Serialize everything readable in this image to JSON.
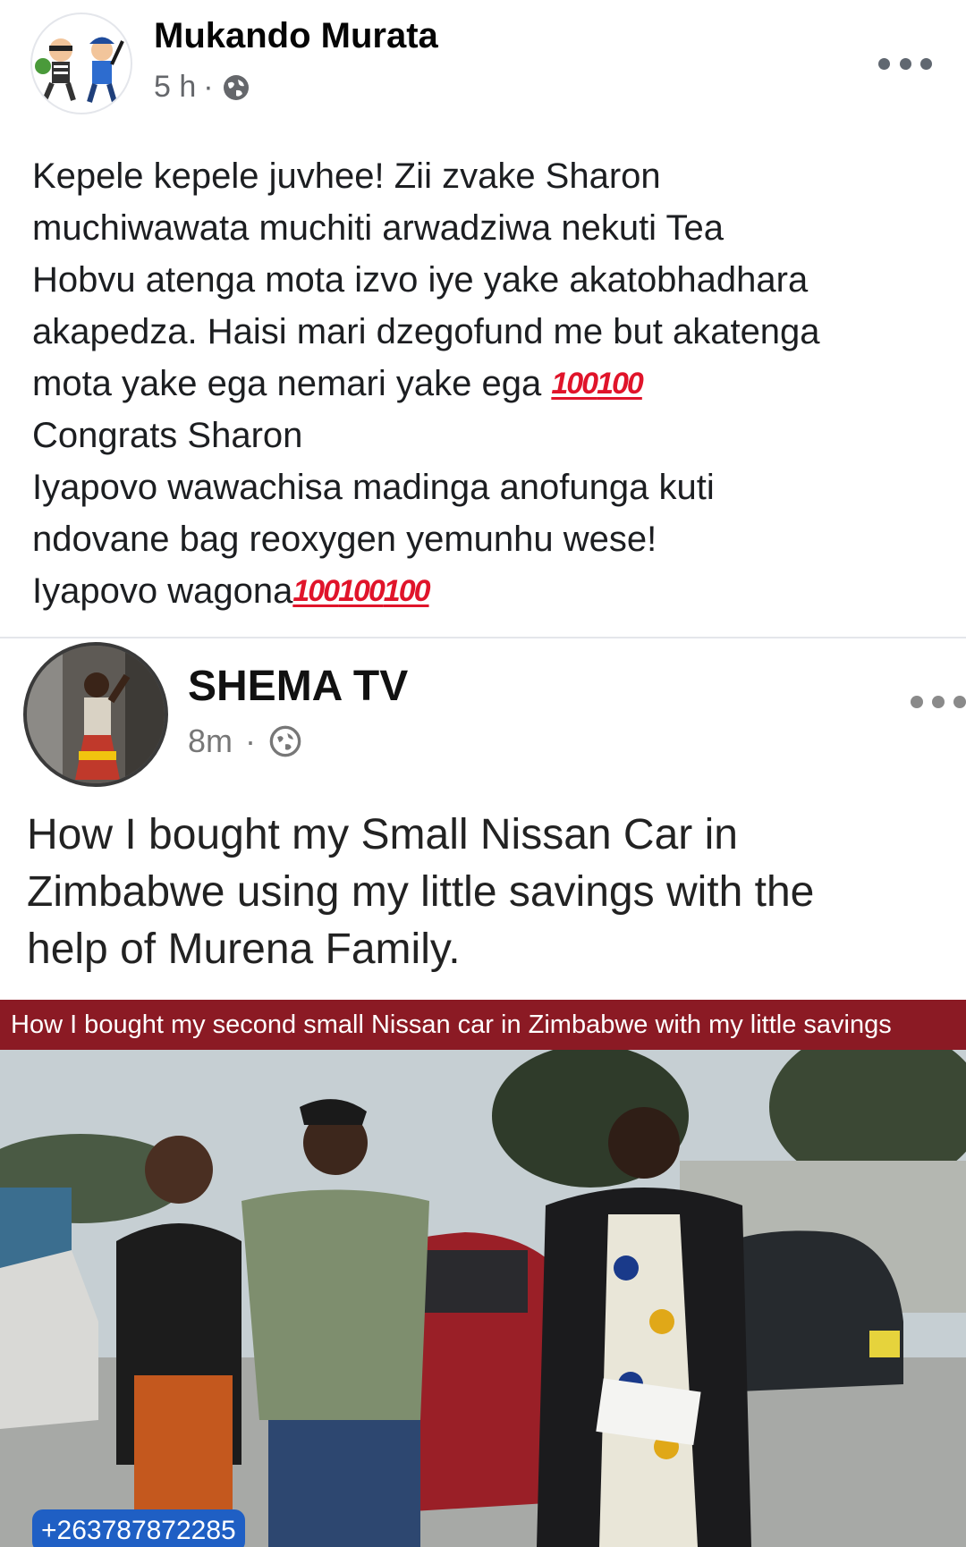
{
  "outer_post": {
    "author": "Mukando Murata",
    "time": "5 h",
    "separator": "·",
    "visibility_icon": "globe-icon",
    "avatar_icon": "cartoon-thief-and-police-avatar",
    "more_icon": "more-options-icon",
    "lines": [
      "Kepele kepele juvhee! Zii zvake Sharon",
      "muchiwawata muchiti arwadziwa nekuti Tea",
      "Hobvu atenga mota izvo iye yake akatobhadhara",
      "akapedza. Haisi mari dzegofund me but akatenga",
      "mota yake ega nemari yake ega",
      "Congrats Sharon",
      "Iyapovo wawachisa madinga anofunga kuti",
      "ndovane bag reoxygen yemunhu wese!",
      "Iyapovo wagona"
    ],
    "emoji_100": "💯"
  },
  "shared_post": {
    "author": "SHEMA TV",
    "time": "8m",
    "separator": "·",
    "visibility_icon": "globe-icon",
    "more_icon": "more-options-icon",
    "lines": [
      "How I bought my Small Nissan Car in",
      "Zimbabwe using my little savings with the",
      "help of Murena Family."
    ],
    "video": {
      "banner": "How I bought my second small Nissan car in Zimbabwe with my little savings",
      "phone": "+263787872285"
    }
  },
  "colors": {
    "banner_bg": "#8b1a24",
    "phone_badge_bg": "#1f5fc4",
    "emoji_red": "#e0142a",
    "meta_gray": "#65676b"
  }
}
